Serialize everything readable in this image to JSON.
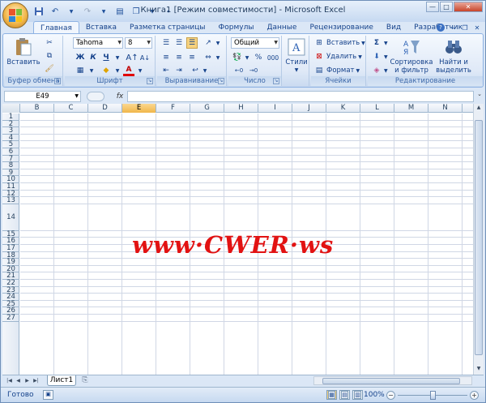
{
  "window": {
    "title": "Книга1  [Режим совместимости] - Microsoft Excel",
    "controls": [
      "—",
      "□",
      "✕"
    ]
  },
  "tabs": [
    "Главная",
    "Вставка",
    "Разметка страницы",
    "Формулы",
    "Данные",
    "Рецензирование",
    "Вид",
    "Разработчик"
  ],
  "active_tab": "Главная",
  "ribbon": {
    "clipboard": {
      "label": "Буфер обмена",
      "paste": "Вставить"
    },
    "font": {
      "label": "Шрифт",
      "font_name": "Tahoma",
      "font_size": "8",
      "bold": "Ж",
      "italic": "К",
      "underline": "Ч",
      "font_color": "A"
    },
    "alignment": {
      "label": "Выравнивание"
    },
    "number": {
      "label": "Число",
      "format": "Общий",
      "percent": "%",
      "thousands": "000"
    },
    "styles": {
      "label": "Стили"
    },
    "cells": {
      "label": "Ячейки",
      "insert": "Вставить",
      "delete": "Удалить",
      "format": "Формат"
    },
    "editing": {
      "label": "Редактирование",
      "sum": "Σ",
      "sort_filter": "Сортировка\nи фильтр",
      "find_select": "Найти и\nвыделить"
    }
  },
  "formula_bar": {
    "name_box": "E49",
    "fx": "fx",
    "formula": ""
  },
  "columns": [
    "B",
    "C",
    "D",
    "E",
    "F",
    "G",
    "H",
    "I",
    "J",
    "K",
    "L",
    "M",
    "N"
  ],
  "selected_column": "E",
  "rows": [
    "1",
    "2",
    "3",
    "4",
    "5",
    "6",
    "7",
    "8",
    "9",
    "10",
    "11",
    "12",
    "13",
    "14",
    "15",
    "16",
    "17",
    "18",
    "19",
    "20",
    "21",
    "22",
    "23",
    "24",
    "25",
    "26",
    "27"
  ],
  "watermark": "www·CWER·ws",
  "sheet_tabs": [
    "Лист1"
  ],
  "status": {
    "ready": "Готово",
    "zoom": "100%"
  },
  "colors": {
    "accent": "#15428b",
    "watermark": "#e21212",
    "selected_header": "#f1b64a"
  }
}
